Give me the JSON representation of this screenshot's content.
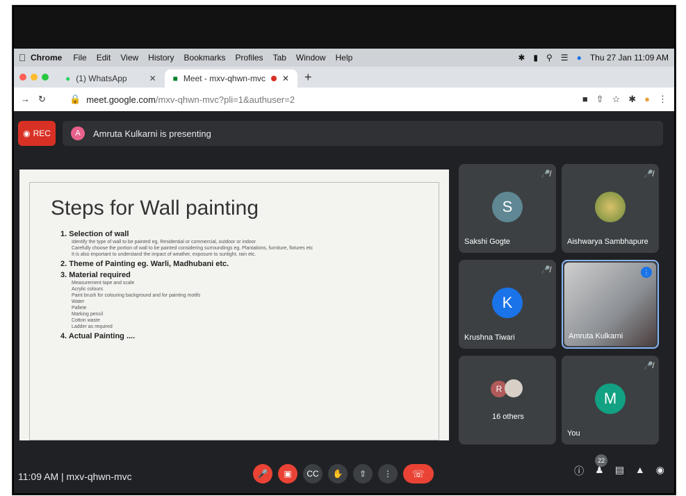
{
  "menubar": {
    "app": "Chrome",
    "items": [
      "File",
      "Edit",
      "View",
      "History",
      "Bookmarks",
      "Profiles",
      "Tab",
      "Window",
      "Help"
    ],
    "datetime": "Thu 27 Jan  11:09 AM"
  },
  "tabs": [
    {
      "label": "(1) WhatsApp"
    },
    {
      "label": "Meet - mxv-qhwn-mvc"
    }
  ],
  "address": {
    "host": "meet.google.com",
    "path": "/mxv-qhwn-mvc?pli=1&authuser=2"
  },
  "meet": {
    "rec_label": "REC",
    "presenter_initial": "A",
    "presenting_text": "Amruta Kulkarni is presenting",
    "slide": {
      "title": "Steps for Wall painting",
      "sections": [
        {
          "label": "1.  Selection of wall",
          "subs": [
            "Identify the type of wall to be painted eg. Residential or commercial, outdoor or indoor",
            "Carefully choose the portion of wall to be painted considering surroundings eg. Plantations, furniture, fixtures etc",
            "It is also important to understand the impact of weather, exposure to sunlight, rain etc."
          ]
        },
        {
          "label": "2.  Theme of Painting eg. Warli, Madhubani etc.",
          "subs": []
        },
        {
          "label": "3.  Material required",
          "subs": [
            "Measurement tape and scale",
            "Acrylic colours",
            "Paint brush for colouring background and for painting motifs",
            "Water",
            "Pallete",
            "Marking pencil",
            "Cotton waste",
            "Ladder as required"
          ]
        },
        {
          "label": "4.  Actual Painting ....",
          "subs": []
        }
      ]
    },
    "participants": [
      {
        "name": "Sakshi Gogte",
        "initial": "S",
        "color": "#5f8794"
      },
      {
        "name": "Aishwarya Sambhapure",
        "initial": "",
        "color": "#3c4043"
      },
      {
        "name": "Krushna Tiwari",
        "initial": "K",
        "color": "#1a73e8"
      },
      {
        "name": "Amruta Kulkarni",
        "initial": "",
        "color": "#3c4043"
      },
      {
        "name": "16 others",
        "initial": "R",
        "color": "#b05a5a"
      },
      {
        "name": "You",
        "initial": "M",
        "color": "#12a182"
      }
    ],
    "meeting_info": "11:09 AM  |  mxv-qhwn-mvc",
    "participants_count": "22"
  }
}
